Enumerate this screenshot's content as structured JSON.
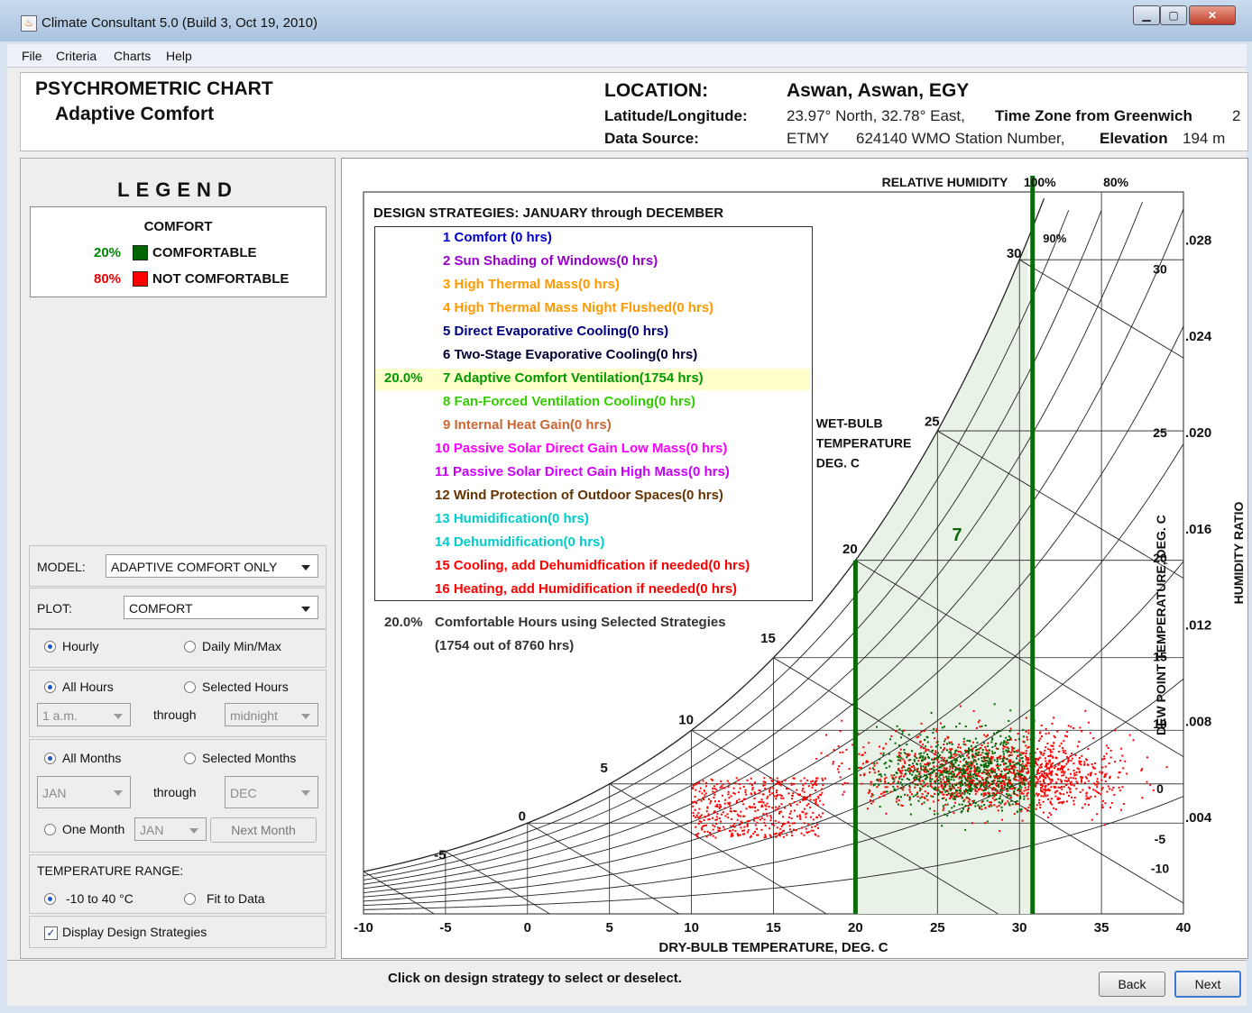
{
  "window": {
    "title": "Climate Consultant 5.0 (Build 3, Oct 19, 2010)"
  },
  "menu": {
    "items": [
      "File",
      "Criteria",
      "Charts",
      "Help"
    ]
  },
  "header": {
    "chart_title": "PSYCHROMETRIC CHART",
    "chart_subtitle": "Adaptive Comfort",
    "location_label": "LOCATION:",
    "location_value": "Aswan, Aswan, EGY",
    "latlon_label": "Latitude/Longitude:",
    "latlon_value": "23.97° North, 32.78° East,",
    "timezone_label": "Time Zone from Greenwich",
    "timezone_value": "2",
    "source_label": "Data Source:",
    "source_value": "ETMY",
    "station_value": "624140 WMO Station Number,",
    "elevation_label": "Elevation",
    "elevation_value": "194 m"
  },
  "legend": {
    "title": "LEGEND",
    "box_title": "COMFORT",
    "comfortable_pct": "20%",
    "comfortable_label": "COMFORTABLE",
    "not_comfortable_pct": "80%",
    "not_comfortable_label": "NOT COMFORTABLE",
    "comfortable_color": "#006400",
    "not_comfortable_color": "#ff0000"
  },
  "controls": {
    "model_label": "MODEL:",
    "model_value": "ADAPTIVE COMFORT ONLY",
    "plot_label": "PLOT:",
    "plot_value": "COMFORT",
    "hourly": "Hourly",
    "daily": "Daily Min/Max",
    "all_hours": "All Hours",
    "selected_hours": "Selected Hours",
    "hour_from": "1 a.m.",
    "through": "through",
    "hour_to": "midnight",
    "all_months": "All Months",
    "selected_months": "Selected Months",
    "month_from": "JAN",
    "month_to": "DEC",
    "one_month": "One Month",
    "one_month_value": "JAN",
    "next_month": "Next Month",
    "temp_range_label": "TEMPERATURE RANGE:",
    "temp_range_option": "-10 to 40 °C",
    "fit_to_data": "Fit to Data",
    "display_strategies": "Display Design Strategies"
  },
  "bottom": {
    "hint": "Click on design strategy to select or deselect.",
    "back": "Back",
    "next": "Next"
  },
  "chart_data": {
    "type": "scatter",
    "title": "DESIGN STRATEGIES:  JANUARY through DECEMBER",
    "xlabel": "DRY-BULB TEMPERATURE, DEG. C",
    "ylabel": "HUMIDITY RATIO",
    "rh_label": "RELATIVE HUMIDITY",
    "rh_ticks": [
      "100%",
      "80%"
    ],
    "rh_90": "90%",
    "wet_bulb_label": [
      "WET-BULB",
      "TEMPERATURE",
      "DEG. C"
    ],
    "dew_point_label": "DEW POINT TEMPERATURE, DEG. C",
    "xlim": [
      -10,
      40
    ],
    "x_ticks": [
      "-10",
      "-5",
      "0",
      "5",
      "10",
      "15",
      "20",
      "25",
      "30",
      "35",
      "40"
    ],
    "ylim": [
      0,
      0.03
    ],
    "y_ticks": [
      ".004",
      ".008",
      ".012",
      ".016",
      ".020",
      ".024",
      ".028"
    ],
    "wet_bulb_ticks": [
      "-5",
      "0",
      "5",
      "10",
      "15",
      "20",
      "25",
      "30"
    ],
    "dew_point_ticks": [
      "-10",
      "-5",
      "0",
      "10",
      "15",
      "20",
      "25",
      "30"
    ],
    "comfort_zone": {
      "t_min": 20,
      "t_max": 30.8,
      "label": "7"
    },
    "strategies": [
      {
        "text": "1 Comfort (0 hrs)",
        "color": "#0000cc",
        "pct": ""
      },
      {
        "text": "2 Sun Shading of Windows(0 hrs)",
        "color": "#9900cc",
        "pct": ""
      },
      {
        "text": "3 High Thermal Mass(0 hrs)",
        "color": "#ff9900",
        "pct": ""
      },
      {
        "text": "4 High Thermal Mass Night Flushed(0 hrs)",
        "color": "#ff9900",
        "pct": ""
      },
      {
        "text": "5 Direct Evaporative Cooling(0 hrs)",
        "color": "#00007f",
        "pct": ""
      },
      {
        "text": "6 Two-Stage Evaporative Cooling(0 hrs)",
        "color": "#000033",
        "pct": ""
      },
      {
        "text": "7 Adaptive Comfort Ventilation(1754 hrs)",
        "color": "#009900",
        "pct": "20.0%"
      },
      {
        "text": "8 Fan-Forced Ventilation Cooling(0 hrs)",
        "color": "#33cc00",
        "pct": ""
      },
      {
        "text": "9 Internal Heat Gain(0 hrs)",
        "color": "#cc6633",
        "pct": ""
      },
      {
        "text": "10 Passive Solar Direct Gain Low Mass(0 hrs)",
        "color": "#ff00ff",
        "pct": ""
      },
      {
        "text": "11 Passive Solar Direct Gain High Mass(0 hrs)",
        "color": "#cc00ff",
        "pct": ""
      },
      {
        "text": "12 Wind Protection of Outdoor Spaces(0 hrs)",
        "color": "#663300",
        "pct": ""
      },
      {
        "text": "13 Humidification(0 hrs)",
        "color": "#00cccc",
        "pct": ""
      },
      {
        "text": "14 Dehumidification(0 hrs)",
        "color": "#00cccc",
        "pct": ""
      },
      {
        "text": "15 Cooling, add Dehumidfication if needed(0 hrs)",
        "color": "#ff0000",
        "pct": ""
      },
      {
        "text": "16 Heating, add Humidification if needed(0 hrs)",
        "color": "#ff0000",
        "pct": ""
      }
    ],
    "summary_pct": "20.0%",
    "summary_text": "Comfortable Hours using Selected Strategies",
    "summary_hours": "(1754 out of 8760 hrs)",
    "series": [
      {
        "name": "COMFORTABLE",
        "color": "#006400",
        "hours": 1754
      },
      {
        "name": "NOT COMFORTABLE",
        "color": "#ff0000",
        "hours": 7006
      }
    ]
  }
}
